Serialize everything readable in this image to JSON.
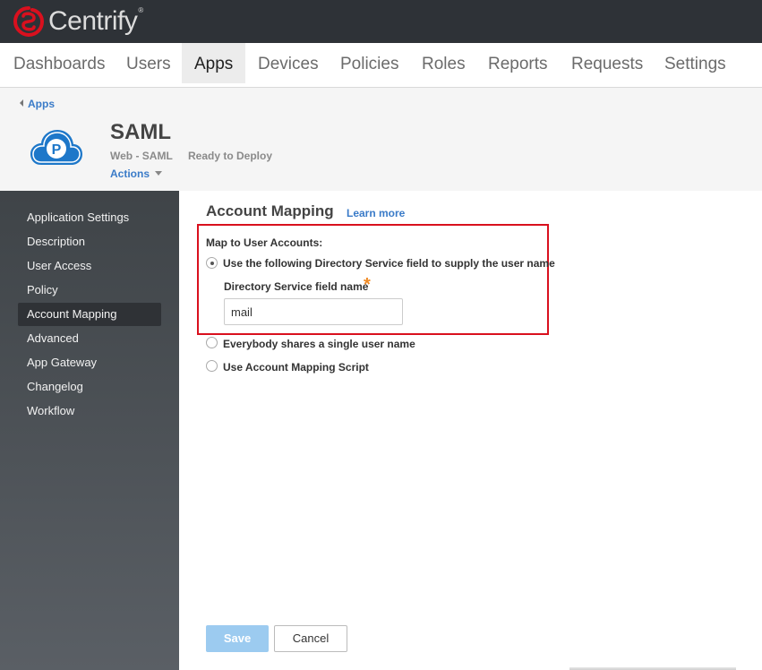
{
  "brand": {
    "name": "Centrify"
  },
  "nav": {
    "items": [
      {
        "label": "Dashboards"
      },
      {
        "label": "Users"
      },
      {
        "label": "Apps"
      },
      {
        "label": "Devices"
      },
      {
        "label": "Policies"
      },
      {
        "label": "Roles"
      },
      {
        "label": "Reports"
      },
      {
        "label": "Requests"
      },
      {
        "label": "Settings"
      }
    ],
    "active": "Apps"
  },
  "app": {
    "back_label": "Apps",
    "title": "SAML",
    "type": "Web - SAML",
    "status": "Ready to Deploy",
    "actions_label": "Actions"
  },
  "sidebar": {
    "items": [
      {
        "label": "Application Settings"
      },
      {
        "label": "Description"
      },
      {
        "label": "User Access"
      },
      {
        "label": "Policy"
      },
      {
        "label": "Account Mapping"
      },
      {
        "label": "Advanced"
      },
      {
        "label": "App Gateway"
      },
      {
        "label": "Changelog"
      },
      {
        "label": "Workflow"
      }
    ],
    "active": "Account Mapping"
  },
  "content": {
    "title": "Account Mapping",
    "learn_more": "Learn more",
    "map_label": "Map to User Accounts:",
    "options": [
      {
        "label": "Use the following Directory Service field to supply the user name",
        "selected": true
      },
      {
        "label": "Everybody shares a single user name",
        "selected": false
      },
      {
        "label": "Use Account Mapping Script",
        "selected": false
      }
    ],
    "field_label": "Directory Service field name",
    "required_marker": "*",
    "field_value": "mail"
  },
  "buttons": {
    "save": "Save",
    "cancel": "Cancel"
  },
  "colors": {
    "brand_red": "#d9101e",
    "link_blue": "#3a7bc8",
    "required_orange": "#f08a24",
    "save_button": "#9ccbf0",
    "sidebar_dark": "#3f4448"
  }
}
